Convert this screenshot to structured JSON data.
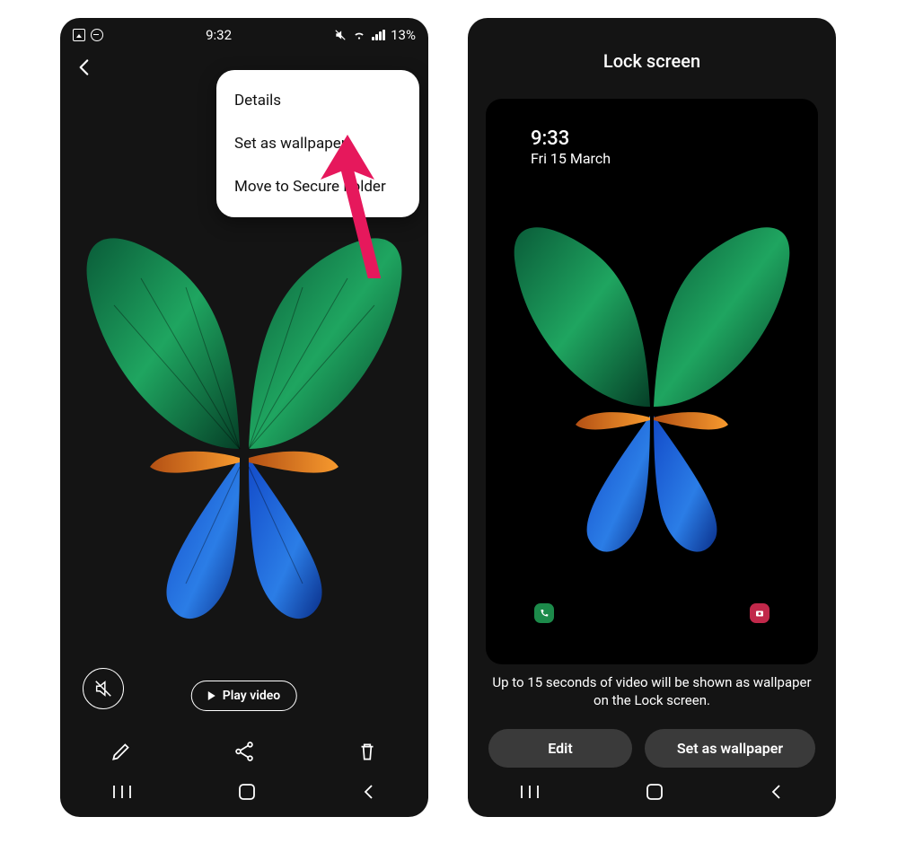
{
  "left": {
    "status": {
      "time": "9:32",
      "battery": "13%"
    },
    "menu": {
      "details": "Details",
      "set_wp": "Set as wallpaper",
      "move": "Move to Secure Folder"
    },
    "play_label": "Play video"
  },
  "right": {
    "title": "Lock screen",
    "clock": {
      "time": "9:33",
      "date": "Fri 15 March"
    },
    "message": "Up to 15 seconds of video will be shown as wallpaper on the Lock screen.",
    "buttons": {
      "edit": "Edit",
      "set_wp": "Set as wallpaper"
    }
  }
}
